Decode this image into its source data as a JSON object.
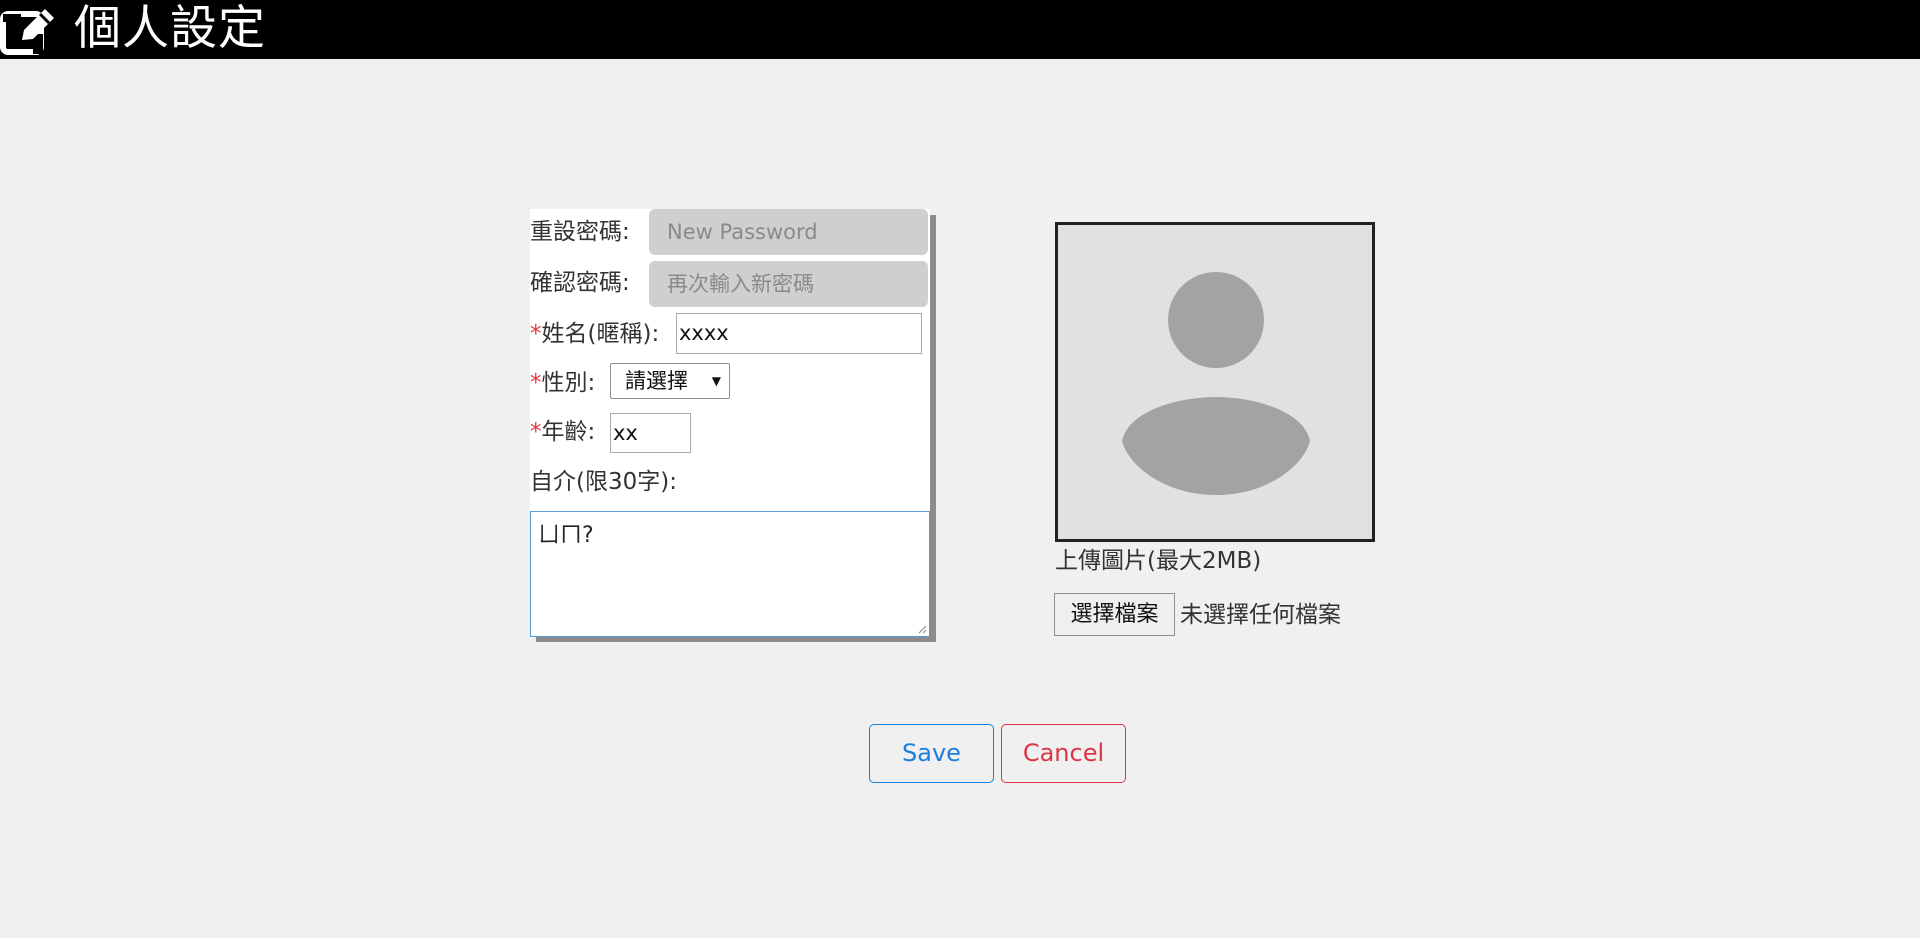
{
  "header": {
    "title": "個人設定",
    "icon": "edit-icon"
  },
  "form": {
    "reset_password": {
      "label": "重設密碼:",
      "placeholder": "New Password"
    },
    "confirm_password": {
      "label": "確認密碼:",
      "placeholder": "再次輸入新密碼"
    },
    "name": {
      "required_mark": "*",
      "label": "姓名(暱稱):",
      "value": "xxxx"
    },
    "gender": {
      "required_mark": "*",
      "label": "性別:",
      "selected": "請選擇"
    },
    "age": {
      "required_mark": "*",
      "label": "年齡:",
      "value": "xx"
    },
    "bio": {
      "label": "自介(限30字):",
      "value": "ㄩㄇ?"
    }
  },
  "avatar": {
    "upload_label": "上傳圖片(最大2MB)",
    "file_button": "選擇檔案",
    "file_status": "未選擇任何檔案"
  },
  "actions": {
    "save": "Save",
    "cancel": "Cancel"
  },
  "colors": {
    "save": "#1a7fe0",
    "cancel": "#dc3545",
    "required": "#e0393e"
  }
}
